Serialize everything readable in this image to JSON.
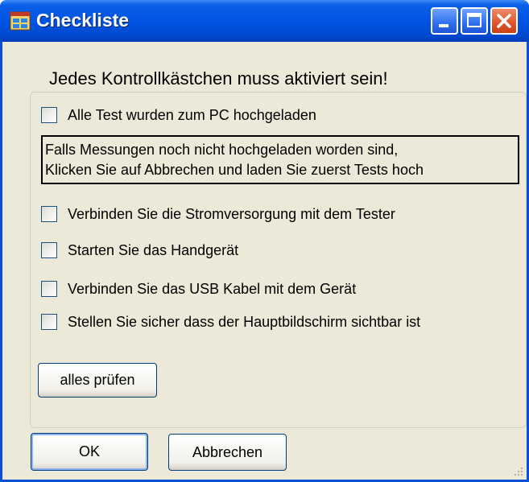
{
  "window": {
    "title": "Checkliste"
  },
  "header": "Jedes Kontrollkästchen muss aktiviert sein!",
  "checklist": [
    {
      "label": "Alle Test wurden zum PC hochgeladen",
      "checked": false
    },
    {
      "label": "Verbinden Sie die Stromversorgung mit dem Tester",
      "checked": false
    },
    {
      "label": "Starten Sie das Handgerät",
      "checked": false
    },
    {
      "label": "Verbinden Sie das USB Kabel mit dem Gerät",
      "checked": false
    },
    {
      "label": "Stellen Sie sicher dass der Hauptbildschirm sichtbar ist",
      "checked": false
    }
  ],
  "note": {
    "line1": "Falls Messungen noch nicht hochgeladen worden sind,",
    "line2": "Klicken Sie auf Abbrechen und laden Sie zuerst Tests hoch"
  },
  "buttons": {
    "check_all": "alles prüfen",
    "ok": "OK",
    "cancel": "Abbrechen"
  },
  "colors": {
    "titlebar": "#0054e3",
    "window_bg": "#ece9d8",
    "close_button": "#e0552a"
  },
  "icons": [
    "app-icon",
    "minimize-icon",
    "maximize-icon",
    "close-icon",
    "resize-grip-icon"
  ]
}
